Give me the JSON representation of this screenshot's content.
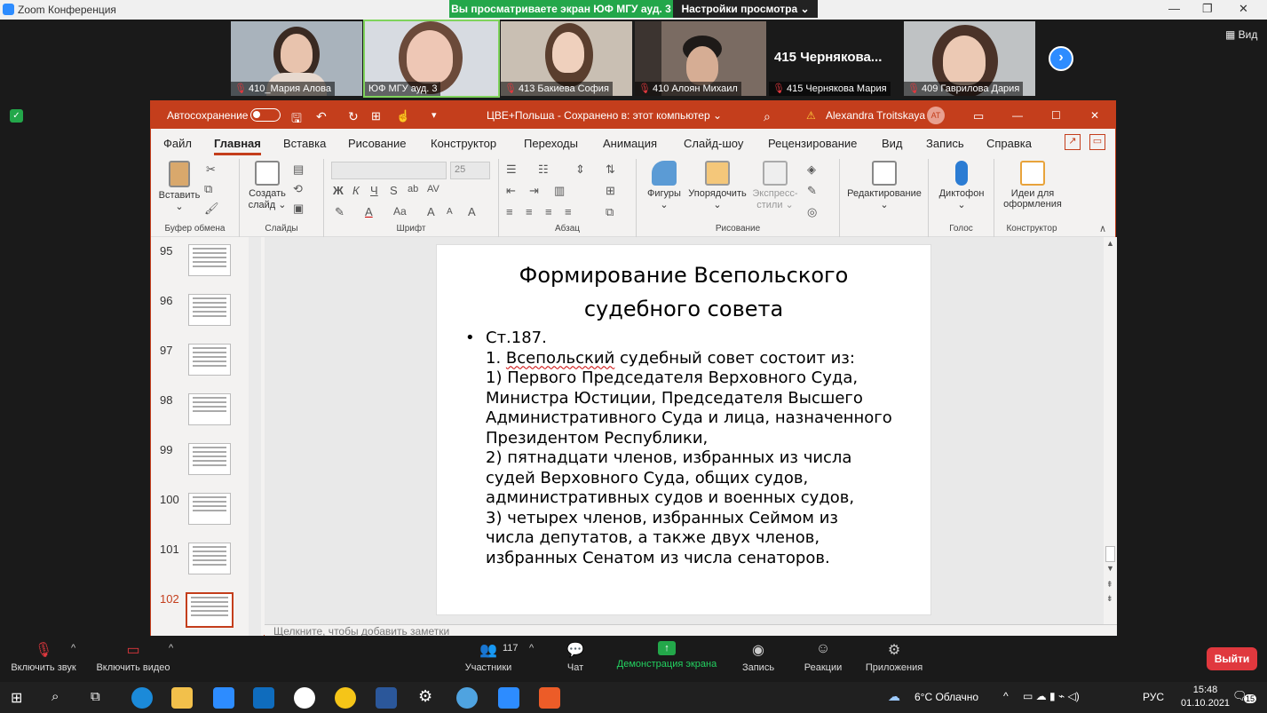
{
  "zoom": {
    "window_title": "Zoom Конференция",
    "share_banner": "Вы просматриваете экран ЮФ МГУ ауд. 3",
    "view_options": "Настройки просмотра ⌄",
    "view_button": "Вид",
    "participants": [
      {
        "name": "410_Мария Алова",
        "muted": true
      },
      {
        "name": "ЮФ МГУ ауд. 3",
        "muted": false
      },
      {
        "name": "413 Бакиева София",
        "muted": true
      },
      {
        "name": "410 Алоян Михаил",
        "muted": true
      },
      {
        "name": "415 Чернякова Мария",
        "muted": true,
        "big_label": "415 Чернякова..."
      },
      {
        "name": "409 Гаврилова Дария",
        "muted": true
      }
    ],
    "toolbar": {
      "mic": "Включить звук",
      "video": "Включить видео",
      "participants": "Участники",
      "participants_count": "117",
      "chat": "Чат",
      "share": "Демонстрация экрана",
      "record": "Запись",
      "reactions": "Реакции",
      "apps": "Приложения",
      "leave": "Выйти"
    }
  },
  "powerpoint": {
    "autosave": "Автосохранение",
    "doc_title": "ЦВЕ+Польша - Сохранено в: этот компьютер ⌄",
    "user": "Alexandra Troitskaya",
    "user_initials": "AT",
    "tabs": [
      "Файл",
      "Главная",
      "Вставка",
      "Рисование",
      "Конструктор",
      "Переходы",
      "Анимация",
      "Слайд-шоу",
      "Рецензирование",
      "Вид",
      "Запись",
      "Справка"
    ],
    "active_tab": "Главная",
    "ribbon": {
      "paste": "Вставить",
      "clipboard_group": "Буфер обмена",
      "new_slide_1": "Создать",
      "new_slide_2": "слайд ⌄",
      "slides_group": "Слайды",
      "font_size": "25",
      "font_group": "Шрифт",
      "paragraph_group": "Абзац",
      "shapes": "Фигуры",
      "arrange": "Упорядочить",
      "styles_1": "Экспресс-",
      "styles_2": "стили ⌄",
      "drawing_group": "Рисование",
      "editing": "Редактирование",
      "dictate": "Диктофон",
      "voice_group": "Голос",
      "ideas_1": "Идеи для",
      "ideas_2": "оформления",
      "designer_group": "Конструктор"
    },
    "thumbnails": [
      "95",
      "96",
      "97",
      "98",
      "99",
      "100",
      "101",
      "102"
    ],
    "slide": {
      "title_line1": "Формирование Всепольского",
      "title_line2": "судебного совета",
      "body_lines": [
        "Ст.187.",
        "1. Всепольский судебный совет состоит из:",
        "1) Первого Председателя Верховного Суда,",
        "Министра Юстиции, Председателя Высшего",
        "Административного Суда и лица, назначенного",
        "Президентом Республики,",
        "2) пятнадцати членов, избранных из числа",
        "судей Верховного Суда, общих судов,",
        "административных судов и военных судов,",
        "3) четырех членов, избранных Сеймом из",
        "числа депутатов, а также двух членов,",
        "избранных Сенатом из числа сенаторов."
      ]
    },
    "notes_placeholder": "Щелкните, чтобы добавить заметки"
  },
  "taskbar": {
    "weather": "6°C  Облачно",
    "lang": "РУС",
    "time": "15:48",
    "date": "01.10.2021",
    "notifications": "15"
  }
}
